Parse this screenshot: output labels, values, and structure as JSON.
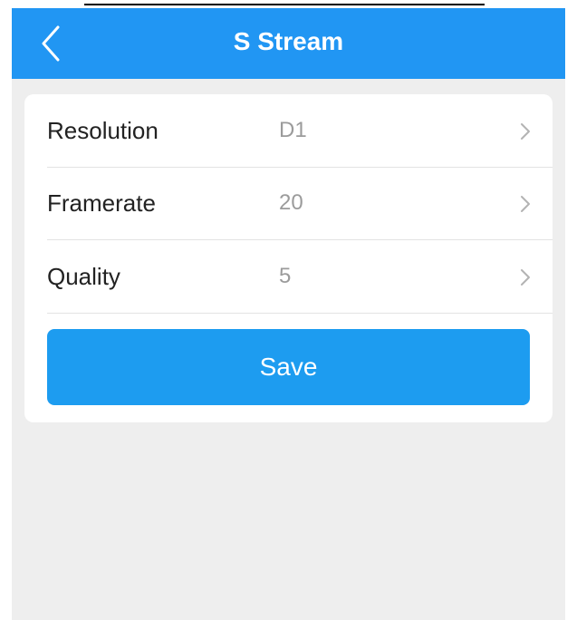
{
  "colors": {
    "header_background": "#2196f3",
    "page_background": "#eeeeee",
    "card_background": "#ffffff",
    "save_button_background": "#1d9cf0",
    "value_text": "#9b9b9b",
    "label_text": "#222222"
  },
  "header": {
    "back_icon": "chevron-left-icon",
    "title": "S Stream"
  },
  "settings": [
    {
      "label": "Resolution",
      "value": "D1",
      "icon": "chevron-right-icon"
    },
    {
      "label": "Framerate",
      "value": "20",
      "icon": "chevron-right-icon"
    },
    {
      "label": "Quality",
      "value": "5",
      "icon": "chevron-right-icon"
    }
  ],
  "actions": {
    "save_label": "Save"
  }
}
